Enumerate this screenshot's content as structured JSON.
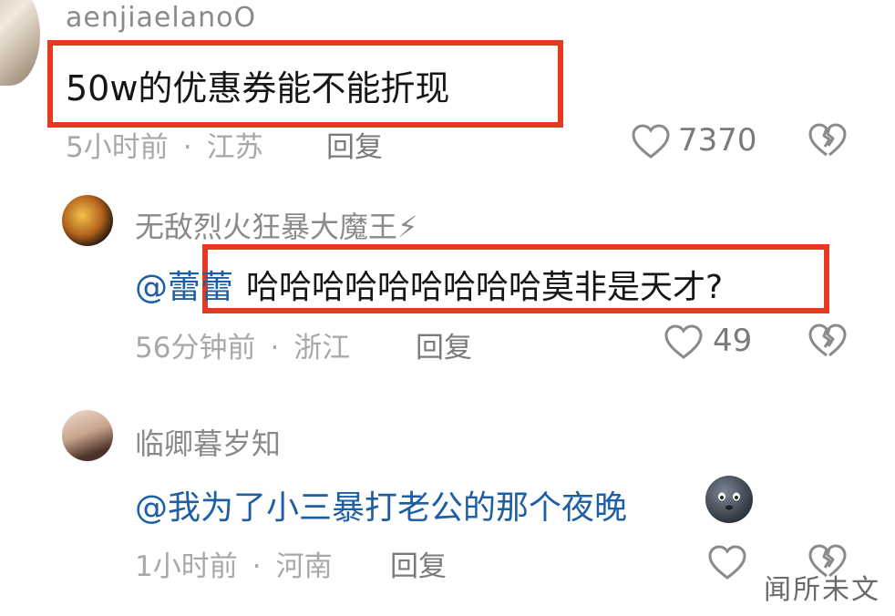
{
  "comments": [
    {
      "username": "aenjiaelanoO",
      "text": "50w的优惠券能不能折现",
      "time": "5小时前",
      "location": "江苏",
      "reply_label": "回复",
      "likes": "7370"
    },
    {
      "username": "无敌烈火狂暴大魔王⚡",
      "mention": "@蕾蕾",
      "text": "哈哈哈哈哈哈哈哈哈莫非是天才?",
      "time": "56分钟前",
      "location": "浙江",
      "reply_label": "回复",
      "likes": "49"
    },
    {
      "username": "临卿暮岁知",
      "mention": "@我为了小三暴打老公的那个夜晚",
      "time": "1小时前",
      "location": "河南",
      "reply_label": "回复",
      "likes": ""
    }
  ],
  "separator": "·",
  "watermark": "闻所未文",
  "colors": {
    "highlight_box": "#e53a1f",
    "mention": "#1d5fa5"
  },
  "icons": [
    "heart-outline-icon",
    "broken-heart-icon",
    "emoji-face-icon"
  ]
}
